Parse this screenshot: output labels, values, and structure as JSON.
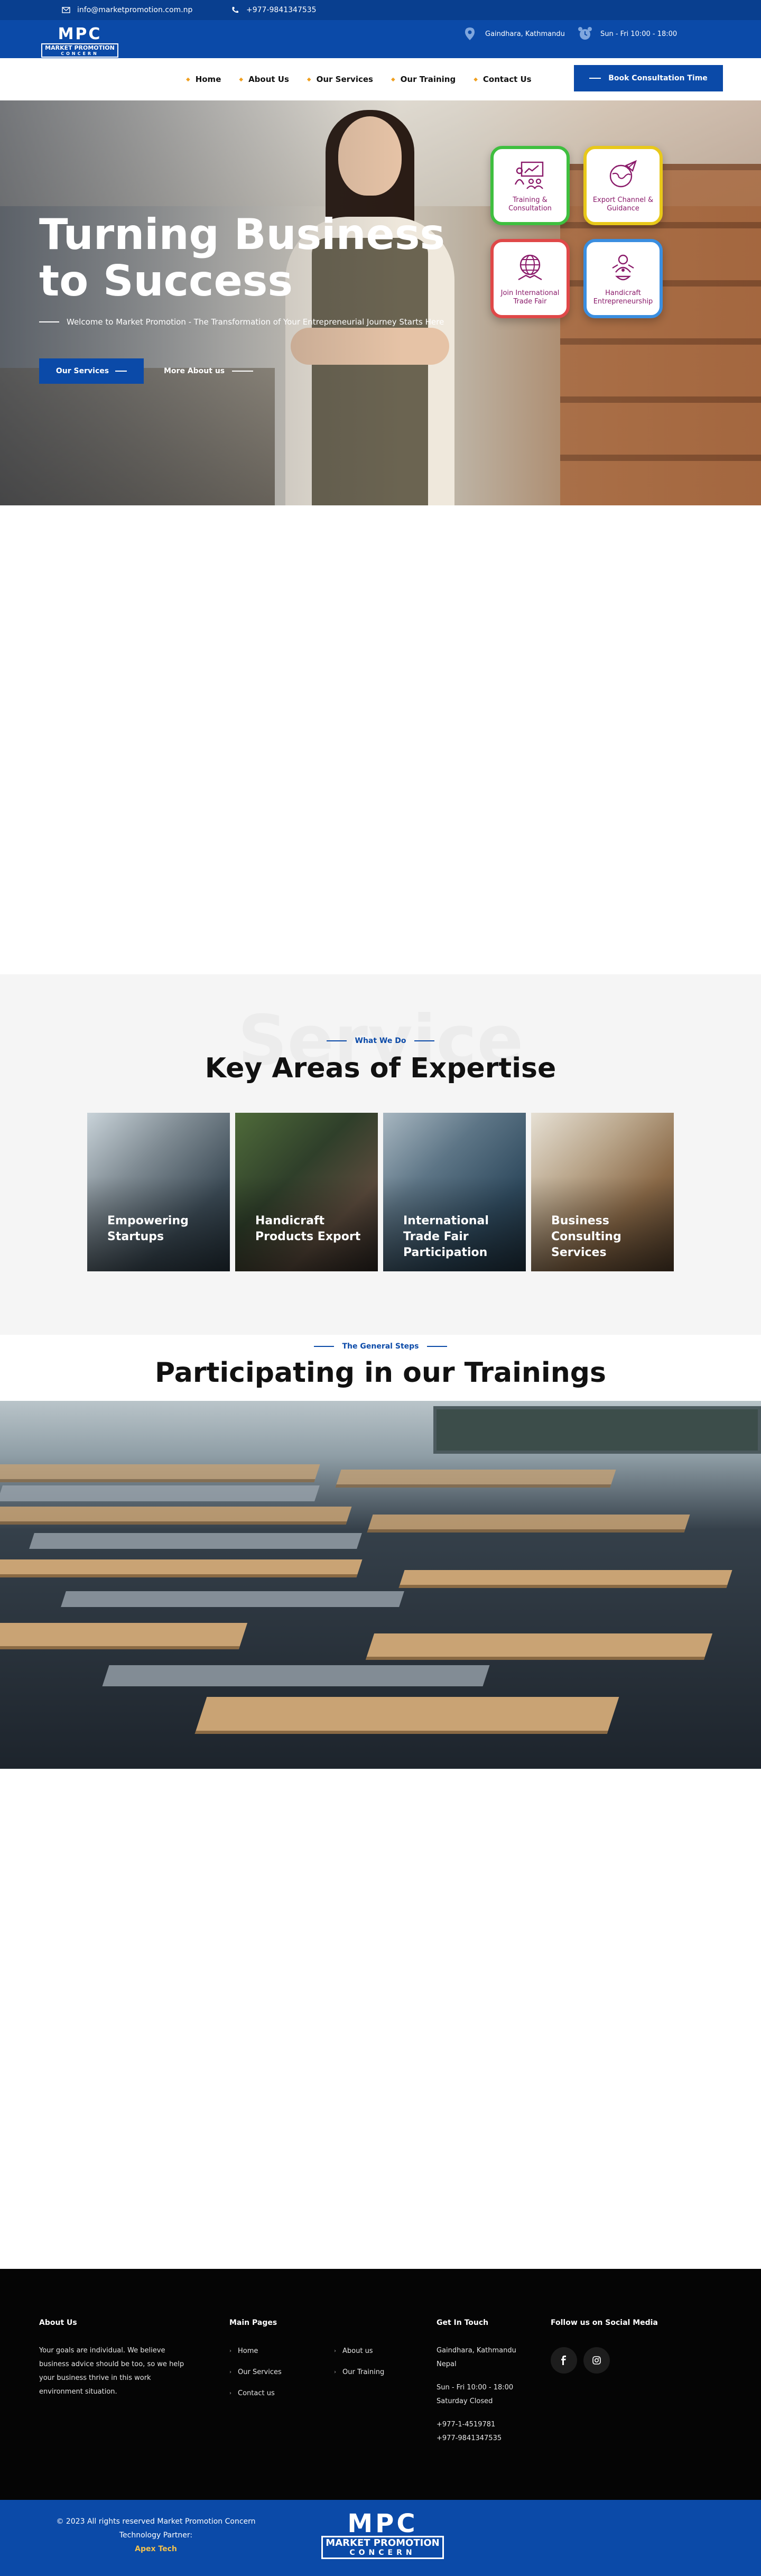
{
  "topbar": {
    "email": "info@marketpromotion.com.np",
    "phone": "+977-9841347535",
    "address": "Gaindhara, Kathmandu",
    "hours": "Sun - Fri 10:00 - 18:00"
  },
  "logo": {
    "mark": "MPC",
    "name": "MARKET PROMOTION",
    "sub": "CONCERN"
  },
  "nav": {
    "items": [
      "Home",
      "About Us",
      "Our Services",
      "Our Training",
      "Contact Us"
    ],
    "cta": "Book Consultation Time"
  },
  "hero": {
    "title_line1": "Turning Business",
    "title_line2": "to Success",
    "subtitle": "Welcome to Market Promotion - The Transformation of Your Entrepreneurial Journey Starts Here",
    "btn_primary": "Our Services",
    "btn_secondary": "More About us",
    "cards": [
      {
        "label": "Training & Consultation",
        "color": "#3fbf3f",
        "icon": "training-icon"
      },
      {
        "label": "Export Channel & Guidance",
        "color": "#e8c81a",
        "icon": "export-icon"
      },
      {
        "label": "Join International Trade Fair",
        "color": "#e04848",
        "icon": "globe-icon"
      },
      {
        "label": "Handicraft Entrepreneurship",
        "color": "#3a8ee0",
        "icon": "handicraft-icon"
      }
    ]
  },
  "expertise": {
    "watermark": "Service",
    "eyebrow": "What We Do",
    "title": "Key Areas of Expertise",
    "cards": [
      "Empowering Startups",
      "Handicraft Products Export",
      "International Trade Fair Participation",
      "Business Consulting Services"
    ]
  },
  "trainings": {
    "eyebrow": "The General Steps",
    "title": "Participating in our Trainings"
  },
  "footer": {
    "about_head": "About Us",
    "about_text": "Your goals are individual. We believe business advice should be too, so we help your business thrive in this work environment situation.",
    "pages_head": "Main Pages",
    "pages_col1": [
      "Home",
      "Our Services",
      "Contact us"
    ],
    "pages_col2": [
      "About us",
      "Our Training"
    ],
    "touch_head": "Get In Touch",
    "touch_address1": "Gaindhara, Kathmandu",
    "touch_address2": "Nepal",
    "touch_hours1": "Sun - Fri 10:00 - 18:00",
    "touch_hours2": "Saturday Closed",
    "touch_phone1": "+977-1-4519781",
    "touch_phone2": "+977-9841347535",
    "social_head": "Follow us on Social Media",
    "copyright": "© 2023 All rights reserved Market Promotion Concern",
    "tech_label": "Technology Partner:",
    "tech_partner": "Apex Tech"
  }
}
